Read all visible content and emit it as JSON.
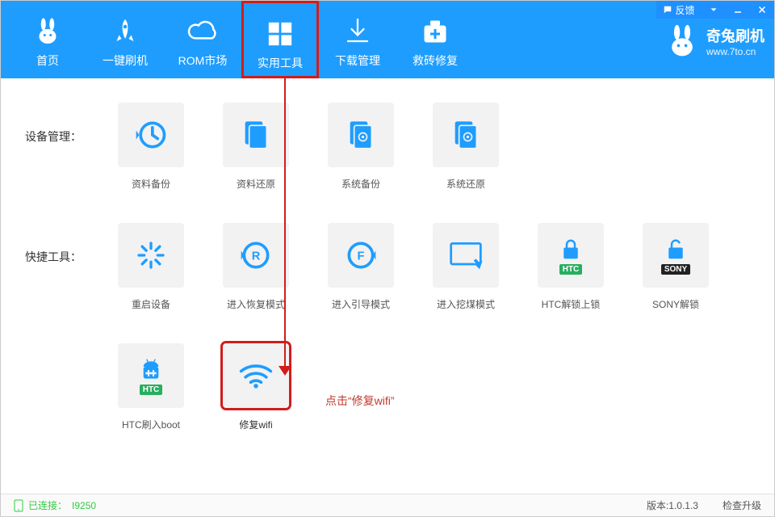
{
  "titlebar": {
    "feedback": "反馈"
  },
  "header": {
    "nav": [
      {
        "label": "首页"
      },
      {
        "label": "一键刷机"
      },
      {
        "label": "ROM市场"
      },
      {
        "label": "实用工具"
      },
      {
        "label": "下载管理"
      },
      {
        "label": "救砖修复"
      }
    ],
    "brand_name": "奇兔刷机",
    "brand_url": "www.7to.cn"
  },
  "sections": {
    "device": {
      "label": "设备管理：",
      "tiles": [
        {
          "label": "资料备份"
        },
        {
          "label": "资料还原"
        },
        {
          "label": "系统备份"
        },
        {
          "label": "系统还原"
        }
      ]
    },
    "quick": {
      "label": "快捷工具：",
      "tiles": [
        {
          "label": "重启设备"
        },
        {
          "label": "进入恢复模式"
        },
        {
          "label": "进入引导模式"
        },
        {
          "label": "进入挖煤模式"
        },
        {
          "label": "HTC解锁上锁",
          "badge": "HTC",
          "badge_color": "#27ae60"
        },
        {
          "label": "SONY解锁",
          "badge": "SONY",
          "badge_color": "#222"
        }
      ]
    },
    "extra": {
      "tiles": [
        {
          "label": "HTC刷入boot",
          "badge": "HTC",
          "badge_color": "#27ae60"
        },
        {
          "label": "修复wifi"
        }
      ]
    }
  },
  "annotation": "点击“修复wifi”",
  "status": {
    "connected": "已连接：",
    "device": "I9250",
    "version_label": "版本:",
    "version": "1.0.1.3",
    "check_update": "检查升级"
  }
}
